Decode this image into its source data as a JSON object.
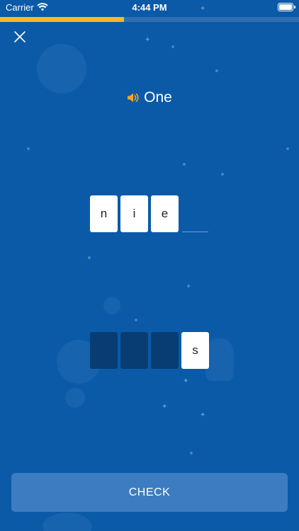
{
  "status_bar": {
    "carrier": "Carrier",
    "time": "4:44 PM"
  },
  "progress": {
    "fraction": 0.415
  },
  "prompt": {
    "word": "One",
    "audio_icon": "speaker-icon"
  },
  "answer_tiles": [
    {
      "letter": "n"
    },
    {
      "letter": "i"
    },
    {
      "letter": "e"
    }
  ],
  "letter_options": [
    {
      "letter": "",
      "used": true
    },
    {
      "letter": "",
      "used": true
    },
    {
      "letter": "",
      "used": true
    },
    {
      "letter": "s",
      "used": false
    }
  ],
  "check_button": {
    "label": "CHECK"
  },
  "colors": {
    "background": "#0a5aa8",
    "progress_fill": "#f6b91f",
    "speaker": "#f6a623",
    "check_button": "#3d7cc0",
    "tile_used": "#083d73"
  },
  "icons": {
    "close": "close-icon",
    "wifi": "wifi-icon",
    "battery": "battery-icon"
  }
}
